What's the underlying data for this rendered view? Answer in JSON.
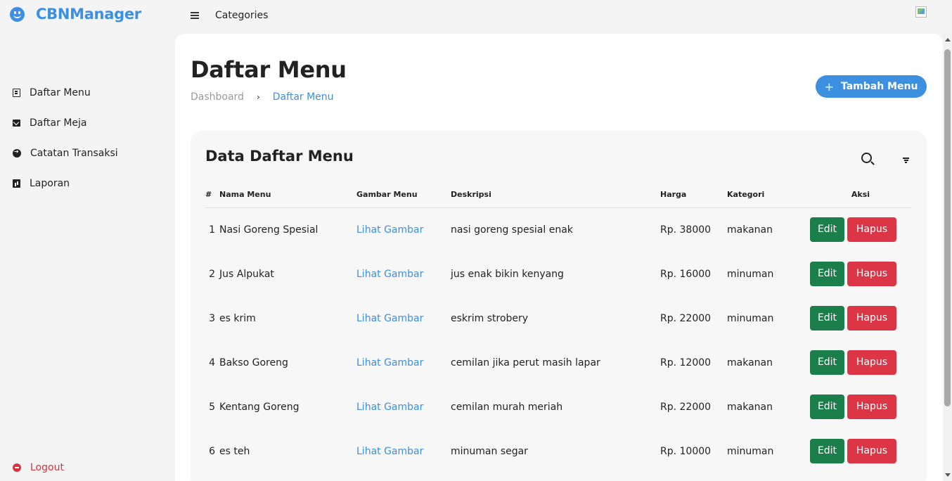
{
  "brand": {
    "title": "CBNManager",
    "icon": "smile-icon",
    "color": "#3d8fe0"
  },
  "topnav": {
    "menu_icon": "hamburger-icon",
    "categories": "Categories",
    "avatar": "user-avatar"
  },
  "sidebar": {
    "items": [
      {
        "label": "Daftar Menu",
        "icon": "book-icon"
      },
      {
        "label": "Daftar Meja",
        "icon": "mail-icon"
      },
      {
        "label": "Catatan Transaksi",
        "icon": "arrow-circle-icon"
      },
      {
        "label": "Laporan",
        "icon": "report-icon"
      }
    ],
    "logout": {
      "label": "Logout",
      "icon": "logout-icon",
      "color": "#d9333f"
    }
  },
  "page": {
    "title": "Daftar Menu",
    "breadcrumb": {
      "home": "Dashboard",
      "separator": "›",
      "current": "Daftar Menu"
    },
    "add_button": {
      "icon": "+",
      "label": "Tambah Menu"
    }
  },
  "card": {
    "title": "Data Daftar Menu",
    "columns": [
      "#",
      "Nama Menu",
      "Gambar Menu",
      "Deskripsi",
      "Harga",
      "Kategori",
      "Aksi"
    ],
    "rows": [
      {
        "no": "1",
        "name": "Nasi Goreng Spesial",
        "image_link": "Lihat Gambar",
        "desc": "nasi goreng spesial enak",
        "price": "Rp. 38000",
        "category": "makanan"
      },
      {
        "no": "2",
        "name": "Jus Alpukat",
        "image_link": "Lihat Gambar",
        "desc": "jus enak bikin kenyang",
        "price": "Rp. 16000",
        "category": "minuman"
      },
      {
        "no": "3",
        "name": "es krim",
        "image_link": "Lihat Gambar",
        "desc": "eskrim strobery",
        "price": "Rp. 22000",
        "category": "minuman"
      },
      {
        "no": "4",
        "name": "Bakso Goreng",
        "image_link": "Lihat Gambar",
        "desc": "cemilan jika perut masih lapar",
        "price": "Rp. 12000",
        "category": "makanan"
      },
      {
        "no": "5",
        "name": "Kentang Goreng",
        "image_link": "Lihat Gambar",
        "desc": "cemilan murah meriah",
        "price": "Rp. 22000",
        "category": "makanan"
      },
      {
        "no": "6",
        "name": "es teh",
        "image_link": "Lihat Gambar",
        "desc": "minuman segar",
        "price": "Rp. 10000",
        "category": "minuman"
      }
    ],
    "actions": {
      "edit": "Edit",
      "delete": "Hapus"
    }
  },
  "colors": {
    "primary": "#3d8fe0",
    "edit": "#1b7f4c",
    "delete": "#dc3545"
  }
}
